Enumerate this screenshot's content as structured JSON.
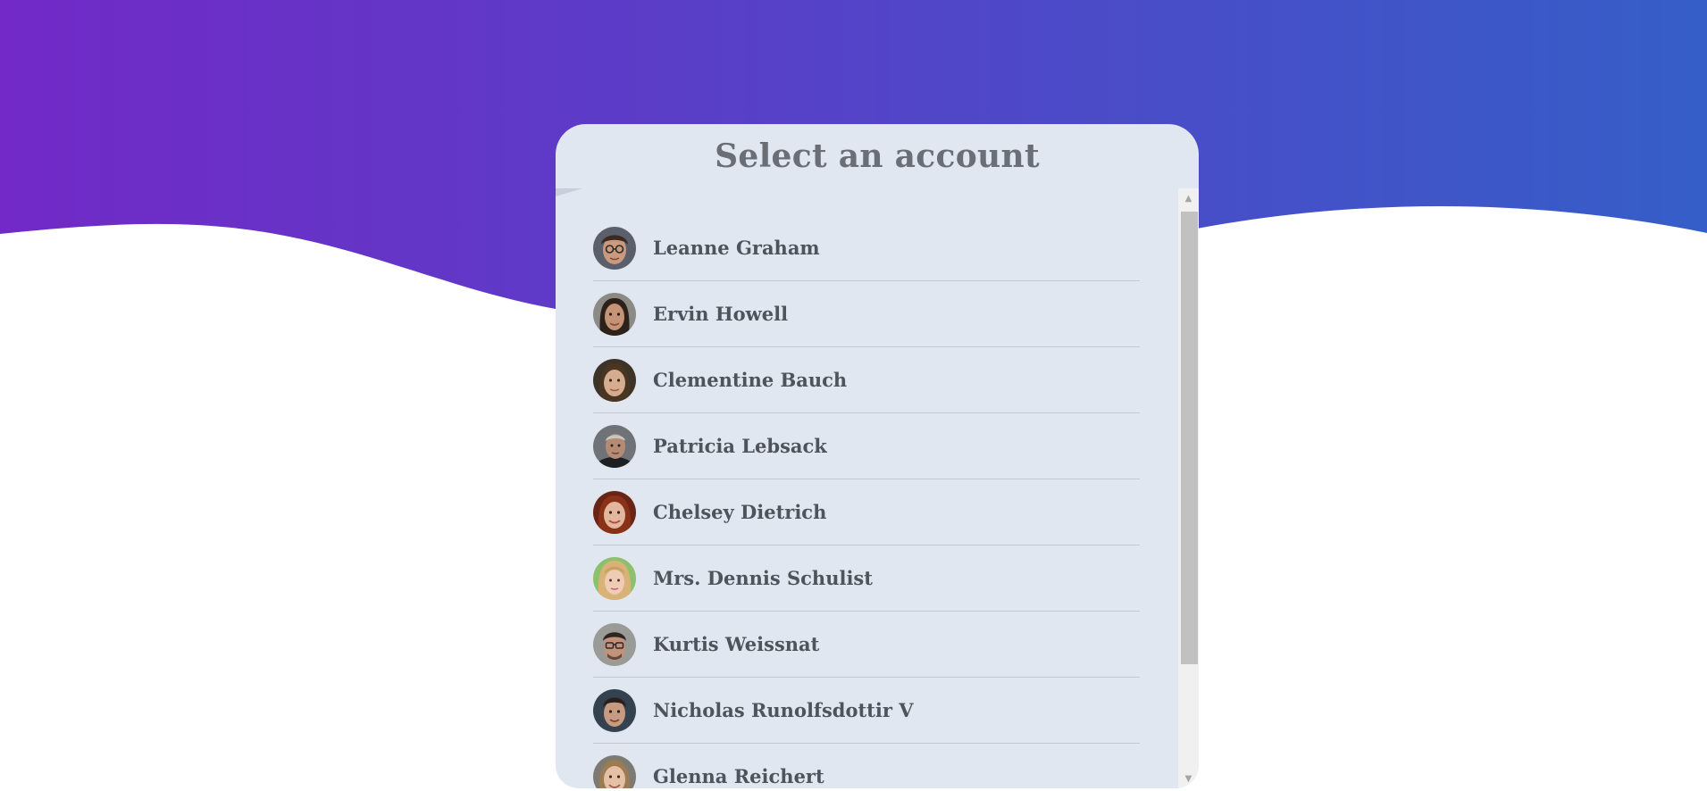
{
  "page": {
    "title": "Select an account"
  },
  "colors": {
    "gradient_start": "#7229c7",
    "gradient_end": "#355ec8",
    "card_background": "#e0e7f0",
    "text": "#4f535b"
  },
  "accounts": [
    {
      "name": "Leanne Graham",
      "avatar": "man-with-glasses"
    },
    {
      "name": "Ervin Howell",
      "avatar": "woman-dark-hair"
    },
    {
      "name": "Clementine Bauch",
      "avatar": "woman-brown-hair"
    },
    {
      "name": "Patricia Lebsack",
      "avatar": "older-man"
    },
    {
      "name": "Chelsey Dietrich",
      "avatar": "woman-red-hair"
    },
    {
      "name": "Mrs. Dennis Schulist",
      "avatar": "girl-blonde"
    },
    {
      "name": "Kurtis Weissnat",
      "avatar": "man-with-glasses"
    },
    {
      "name": "Nicholas Runolfsdottir V",
      "avatar": "young-man"
    },
    {
      "name": "Glenna Reichert",
      "avatar": "woman-smiling"
    }
  ],
  "scrollbar": {
    "icons": {
      "up": "triangle-up-icon",
      "down": "triangle-down-icon"
    },
    "position": 0
  }
}
